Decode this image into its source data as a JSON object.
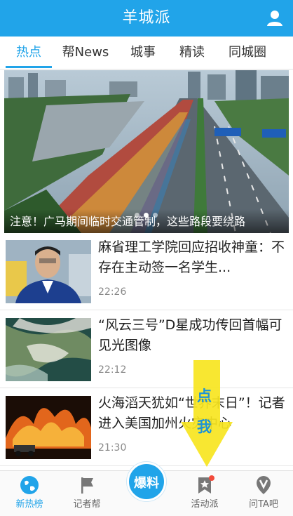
{
  "app": {
    "title": "羊城派",
    "profile_icon": "user-icon",
    "accent": "#21a4e9"
  },
  "tabs": [
    {
      "label": "热点",
      "active": true
    },
    {
      "label": "帮News",
      "active": false
    },
    {
      "label": "城事",
      "active": false
    },
    {
      "label": "精读",
      "active": false
    },
    {
      "label": "同城圈",
      "active": false
    }
  ],
  "banner": {
    "caption": "注意！广马期间临时交通管制，这些路段要绕路",
    "slide_count": 3,
    "active_slide": 2
  },
  "news": [
    {
      "title": "麻省理工学院回应招收神童：不存在主动签一名学生...",
      "time": "22:26"
    },
    {
      "title": "“风云三号”D星成功传回首幅可见光图像",
      "time": "22:12"
    },
    {
      "title": "火海滔天犹如“世界末日”！记者进入美国加州火灾中心",
      "time": "21:30"
    }
  ],
  "hint": {
    "line1": "点",
    "line2": "我"
  },
  "bottom_nav": {
    "items": [
      {
        "label": "新热榜",
        "icon": "globe-icon",
        "active": true
      },
      {
        "label": "记者帮",
        "icon": "flag-icon",
        "active": false
      },
      {
        "label": "活动派",
        "icon": "star-bookmark-icon",
        "active": false,
        "badge": true
      },
      {
        "label": "问TA吧",
        "icon": "v-badge-icon",
        "active": false
      }
    ],
    "center": {
      "label": "爆料",
      "icon": "report-icon"
    }
  }
}
